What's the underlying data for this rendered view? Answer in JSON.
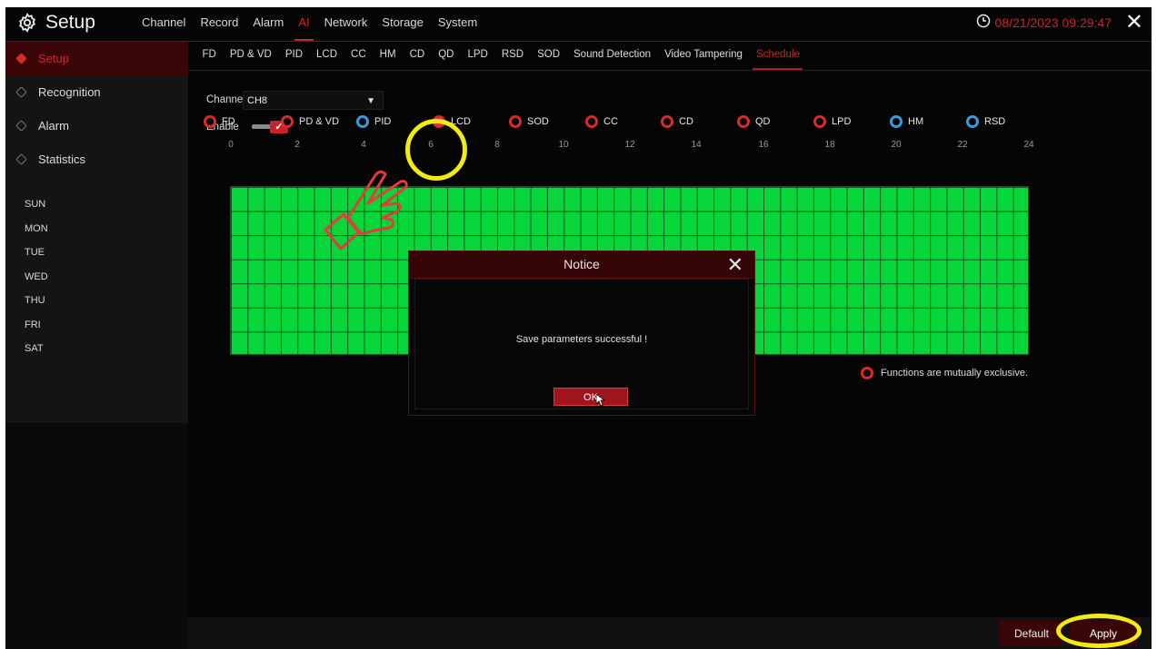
{
  "app": {
    "title": "Setup",
    "datetime": "08/21/2023 09:29:47"
  },
  "top_nav": [
    "Channel",
    "Record",
    "Alarm",
    "AI",
    "Network",
    "Storage",
    "System"
  ],
  "sidebar": {
    "items": [
      {
        "label": "Setup"
      },
      {
        "label": "Recognition"
      },
      {
        "label": "Alarm"
      },
      {
        "label": "Statistics"
      }
    ]
  },
  "sub_tabs": [
    "FD",
    "PD & VD",
    "PID",
    "LCD",
    "CC",
    "HM",
    "CD",
    "QD",
    "LPD",
    "RSD",
    "SOD",
    "Sound Detection",
    "Video Tampering",
    "Schedule"
  ],
  "form": {
    "channel_label": "Channel",
    "channel_value": "CH8",
    "enable_label": "Enable"
  },
  "functions": [
    {
      "label": "FD"
    },
    {
      "label": "PD & VD"
    },
    {
      "label": "PID"
    },
    {
      "label": "LCD"
    },
    {
      "label": "SOD"
    },
    {
      "label": "CC"
    },
    {
      "label": "CD"
    },
    {
      "label": "QD"
    },
    {
      "label": "LPD"
    },
    {
      "label": "HM"
    },
    {
      "label": "RSD"
    }
  ],
  "schedule": {
    "hours": [
      "0",
      "2",
      "4",
      "6",
      "8",
      "10",
      "12",
      "14",
      "16",
      "18",
      "20",
      "22",
      "24"
    ],
    "days": [
      "SUN",
      "MON",
      "TUE",
      "WED",
      "THU",
      "FRI",
      "SAT"
    ],
    "legend": "Functions are mutually exclusive.",
    "fill_color": "#06d63a"
  },
  "dialog": {
    "title": "Notice",
    "message": "Save parameters successful !",
    "ok_label": "OK"
  },
  "footer": {
    "default_label": "Default",
    "apply_label": "Apply"
  },
  "colors": {
    "accent": "#c92128",
    "blue_radio": "#3b9ad9",
    "highlight": "#f4ea13"
  }
}
